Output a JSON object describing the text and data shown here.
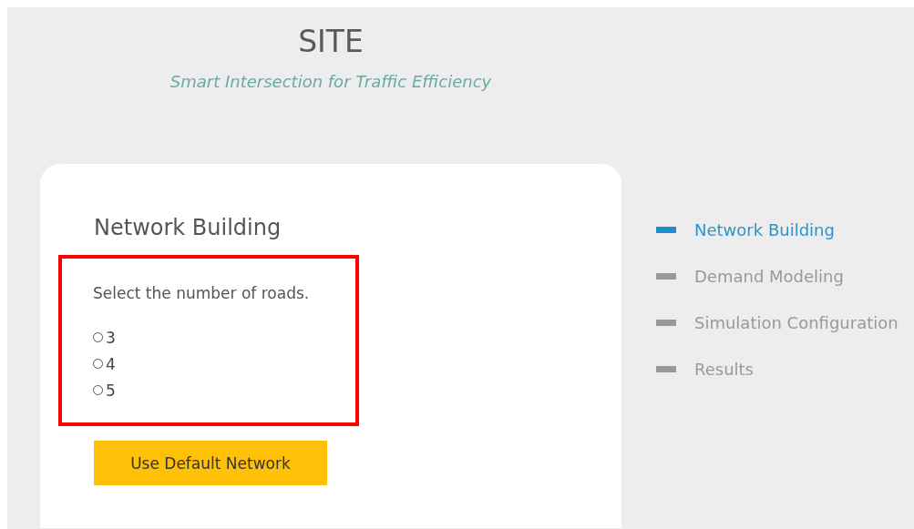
{
  "header": {
    "title": "SITE",
    "subtitle": "Smart Intersection for Traffic Efficiency"
  },
  "card": {
    "heading": "Network Building",
    "highlighted": true,
    "question": "Select the number of roads.",
    "options": [
      {
        "label": "3",
        "selected": false
      },
      {
        "label": "4",
        "selected": false
      },
      {
        "label": "5",
        "selected": false
      }
    ],
    "button": "Use Default Network"
  },
  "steps": [
    {
      "label": "Network Building",
      "selected": true
    },
    {
      "label": "Demand Modeling",
      "selected": false
    },
    {
      "label": "Simulation Configuration",
      "selected": false
    },
    {
      "label": "Results",
      "selected": false
    }
  ]
}
